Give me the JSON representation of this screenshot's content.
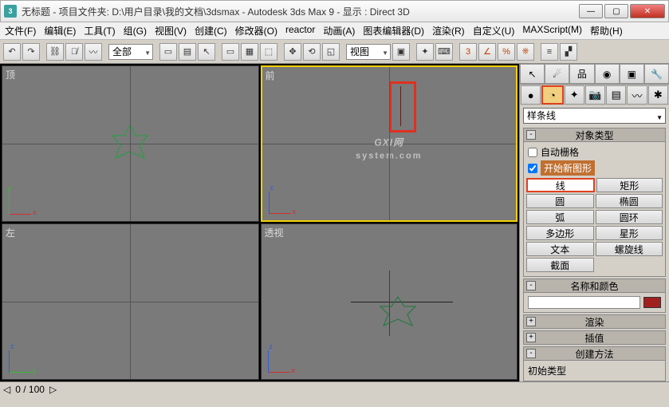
{
  "title": "无标题     - 项目文件夹: D:\\用户目录\\我的文档\\3dsmax       - Autodesk 3ds Max 9       - 显示 : Direct 3D",
  "menubar": [
    "文件(F)",
    "编辑(E)",
    "工具(T)",
    "组(G)",
    "视图(V)",
    "创建(C)",
    "修改器(O)",
    "reactor",
    "动画(A)",
    "图表编辑器(D)",
    "渲染(R)",
    "自定义(U)",
    "MAXScript(M)",
    "帮助(H)"
  ],
  "toolbar_selset": "全部",
  "toolbar_view": "视图",
  "viewports": {
    "tl": "顶",
    "tr": "前",
    "bl": "左",
    "br": "透视"
  },
  "watermark": {
    "big": "GXI网",
    "sub": "system.com"
  },
  "cmdpanel": {
    "dropdown": "样条线",
    "roll_objtype": "对象类型",
    "autogrid": "自动栅格",
    "startnew": "开始新图形",
    "buttons": [
      [
        "线",
        "矩形"
      ],
      [
        "圆",
        "椭圆"
      ],
      [
        "弧",
        "圆环"
      ],
      [
        "多边形",
        "星形"
      ],
      [
        "文本",
        "螺旋线"
      ],
      [
        "截面",
        ""
      ]
    ],
    "roll_name": "名称和颜色",
    "roll_render": "渲染",
    "roll_interp": "插值",
    "roll_create": "创建方法",
    "inittype": "初始类型"
  },
  "status": {
    "frame": "0  /  100"
  }
}
